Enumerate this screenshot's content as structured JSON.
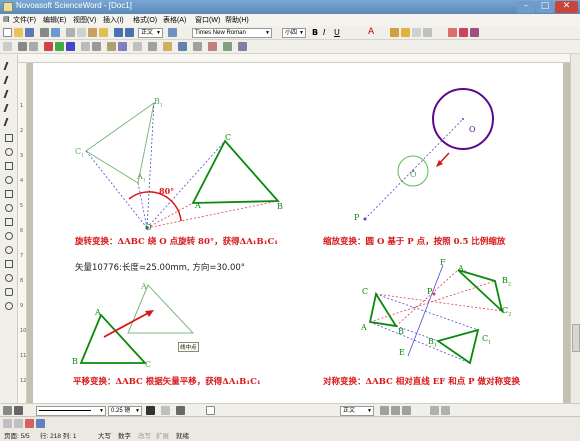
{
  "window": {
    "title": "Novoasoft ScienceWord - [Doc1]",
    "controls": {
      "minimize": "–",
      "maximize": "□",
      "close": "✕"
    }
  },
  "menu": [
    "文件(F)",
    "编辑(E)",
    "视图(V)",
    "插入(I)",
    "格式(O)",
    "表格(A)",
    "窗口(W)",
    "帮助(H)"
  ],
  "format_toolbar": {
    "style_value": "正文",
    "font_value": "Times New Roman",
    "size_value": "小四",
    "bold": "B",
    "italic": "I",
    "underline": "U",
    "color_a": "A"
  },
  "bottom_toolbar": {
    "line_width": "0.25 磅",
    "style": "正文"
  },
  "ruler_numbers": [
    "1",
    "2",
    "3",
    "4",
    "5",
    "6",
    "7",
    "8",
    "9",
    "10",
    "11",
    "12"
  ],
  "figures": {
    "rotation": {
      "labels": {
        "B1": "B",
        "B1_sub": "1",
        "C1": "C",
        "C1_sub": "1",
        "A1": "A",
        "A1_sub": "1",
        "C": "C",
        "A": "A",
        "B": "B",
        "O": "O",
        "angle": "80°"
      },
      "caption": "旋转变换：ΔABC 绕 O 点旋转 80°，获得ΔA₁B₁C₁"
    },
    "scale": {
      "labels": {
        "O_big": "O",
        "O_small": "O",
        "P": "P"
      },
      "caption": "缩放变换：圆 O 基于 P 点，按照 0.5 比例缩放"
    },
    "translation": {
      "vector_info": "矢量10776:长度=25.00mm, 方向=30.00°",
      "tooltip": "线中点",
      "labels": {
        "A1": "A",
        "A": "A",
        "B": "B",
        "C": "C"
      },
      "caption": "平移变换：ΔABC 根据矢量平移，获得ΔA₁B₁C₁"
    },
    "symmetry": {
      "labels": {
        "F": "F",
        "A1": "A",
        "A1_sub": "1",
        "B2": "B",
        "B2_sub": "2",
        "C": "C",
        "P": "P",
        "C2": "C",
        "C2_sub": "2",
        "A": "A",
        "B": "B",
        "B1": "B",
        "B1_sub": "1",
        "C1": "C",
        "C1_sub": "1",
        "E": "E"
      },
      "caption": "对称变换：ΔABC 相对直线 EF 和点 P 做对称变换"
    }
  },
  "status": {
    "page": "页面: 5/5",
    "row": "行: 218 列: 1",
    "mode": "大写",
    "num": "数字",
    "overwrite": "改写",
    "ext": "扩展",
    "ready": "就绪"
  }
}
